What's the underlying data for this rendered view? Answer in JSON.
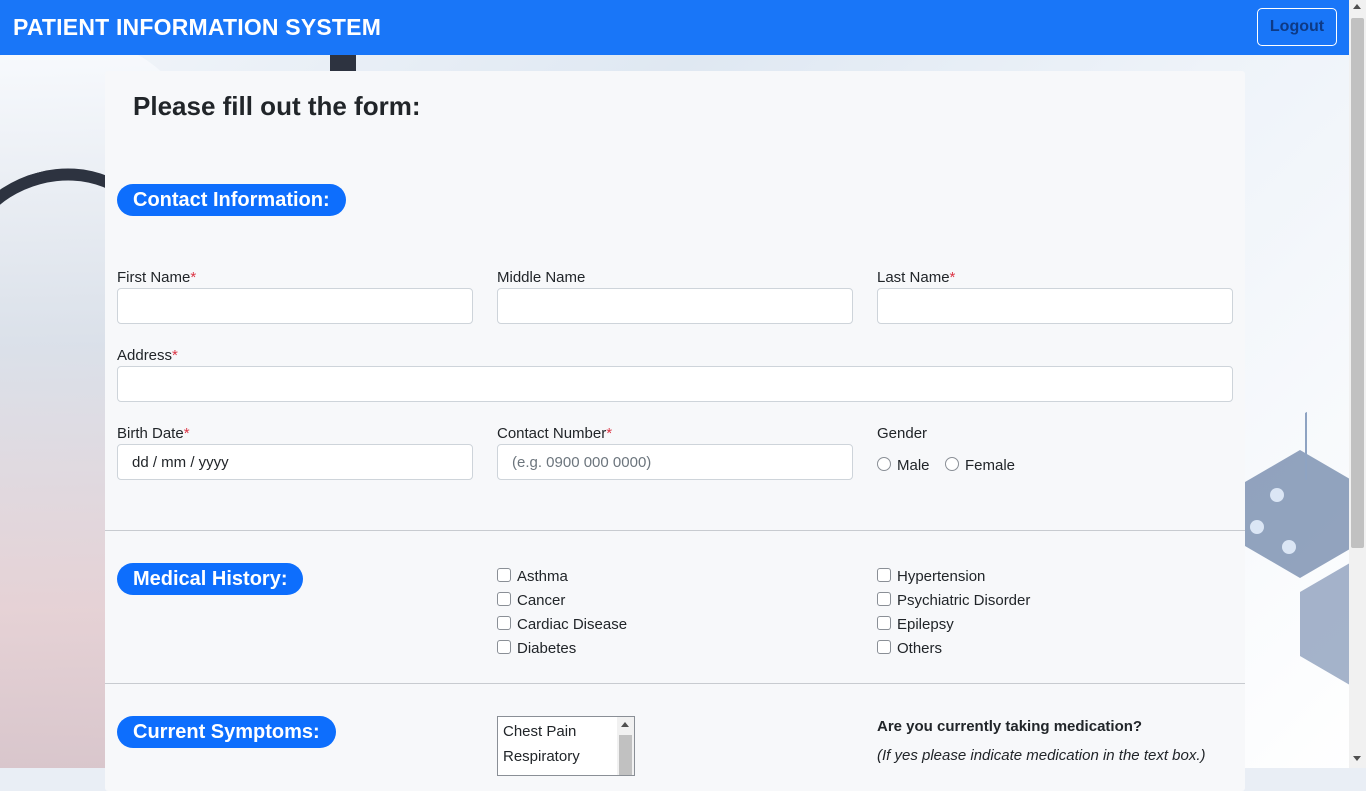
{
  "header": {
    "title": "PATIENT INFORMATION SYSTEM",
    "logout_label": "Logout"
  },
  "form": {
    "title": "Please fill out the form:",
    "contact": {
      "section_label": "Contact Information:",
      "first_name_label": "First Name",
      "middle_name_label": "Middle Name",
      "last_name_label": "Last Name",
      "address_label": "Address",
      "birth_date_label": "Birth Date",
      "birth_date_value": "dd / mm / yyyy",
      "contact_number_label": "Contact Number",
      "contact_number_placeholder": "(e.g. 0900 000 0000)",
      "gender_label": "Gender",
      "gender_options": [
        "Male",
        "Female"
      ],
      "required_marker": "*"
    },
    "medical_history": {
      "section_label": "Medical History:",
      "column1": [
        "Asthma",
        "Cancer",
        "Cardiac Disease",
        "Diabetes"
      ],
      "column2": [
        "Hypertension",
        "Psychiatric Disorder",
        "Epilepsy",
        "Others"
      ]
    },
    "current_symptoms": {
      "section_label": "Current Symptoms:",
      "options": [
        "Chest Pain",
        "Respiratory"
      ],
      "medication_question": "Are you currently taking medication?",
      "medication_hint": "(If yes please indicate medication in the text box.)"
    }
  },
  "colors": {
    "header_bg": "#1976f8",
    "accent": "#0d6efd",
    "required": "#dc3545"
  }
}
